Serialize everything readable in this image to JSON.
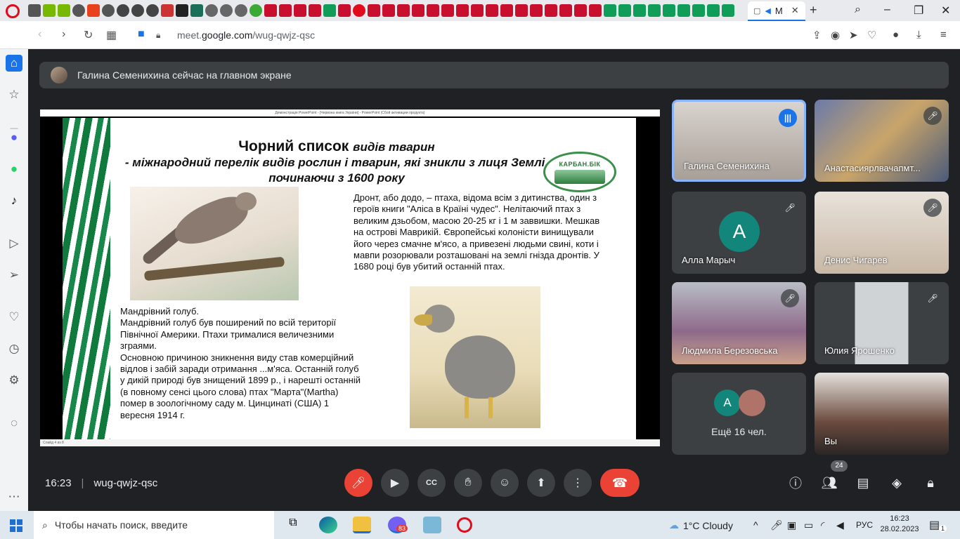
{
  "browser": {
    "active_tab_label": "M",
    "url_prefix": "meet.",
    "url_domain": "google.com",
    "url_path": "/wug-qwjz-qsc"
  },
  "meet": {
    "banner": "Галина Семенихина сейчас на главном экране",
    "meeting_time": "16:23",
    "meeting_code": "wug-qwjz-qsc",
    "people_count": "24"
  },
  "presentation": {
    "window_title": "Демонстрація PowerPoint - [Червона книга України] - PowerPoint (Сбой активации продукта)",
    "title_bold": "Чорний список",
    "title_italic": "видів тварин",
    "subtitle": "- міжнародний перелік видів рослин і тварин, які зникли з лиця Землі, починаючи з 1600 року",
    "logo_text": "КАРБАН.БІК",
    "dodo_text": "Дронт, або додо, – птаха, відома всім з дитинства, один з героїв книги \"Аліса в Країні чудес\". Нелітаючий птах з великим дзьобом, масою 20-25 кг і 1 м заввишки. Мешкав на острові Маврикій. Європейські колоністи винищували його через смачне м'ясо, а привезені людьми свині, коти і мавпи розорювали розташовані на землі гнізда дронтів. У 1680 році був убитий останній птах.",
    "pigeon_text": "Мандрівний голуб.\nМандрівний голуб був поширений по всій території Північної Америки. Птахи трималися величезними зграями.\nОсновною причиною зникнення виду став комерційний відлов і забій заради отримання ...м'яса. Останній голуб у дикій природі був знищений 1899 р., і нарешті останній (в повному сенсі цього слова) птах \"Марта\"(Martha) помер в зоологічному саду м. Цинцинаті (США) 1 вересня 1914 г.",
    "slide_counter": "Слайд 4 из 8"
  },
  "participants": [
    {
      "name": "Галина Семенихина",
      "state": "speaking"
    },
    {
      "name": "Анастасиярлвачапмт...",
      "state": "muted"
    },
    {
      "name": "Алла Марыч",
      "state": "muted",
      "initial": "A"
    },
    {
      "name": "Денис Чигарев",
      "state": "muted"
    },
    {
      "name": "Людмила Березовська",
      "state": "muted"
    },
    {
      "name": "Юлия Ярошенко",
      "state": "muted"
    },
    {
      "name": "Ещё 16 чел.",
      "state": "more",
      "initial": "A"
    },
    {
      "name": "Вы",
      "state": "self"
    }
  ],
  "taskbar": {
    "search_placeholder": "Чтобы начать поиск, введите",
    "viber_badge": "83",
    "weather": "1°C  Cloudy",
    "lang": "РУС",
    "time": "16:23",
    "date": "28.02.2023",
    "notif_count": "1"
  },
  "colors": {
    "meet_bg": "#202124",
    "tile_bg": "#3c4043",
    "accent_blue": "#1a73e8",
    "danger_red": "#ea4335",
    "avatar_teal": "#12867b",
    "stripe_green": "#0f7a3c"
  },
  "icons": [
    "mic-off-icon",
    "camera-icon",
    "captions-icon",
    "raise-hand-icon",
    "emoji-icon",
    "present-icon",
    "more-icon",
    "hangup-icon",
    "info-icon",
    "people-icon",
    "chat-icon",
    "activities-icon",
    "host-controls-icon"
  ]
}
